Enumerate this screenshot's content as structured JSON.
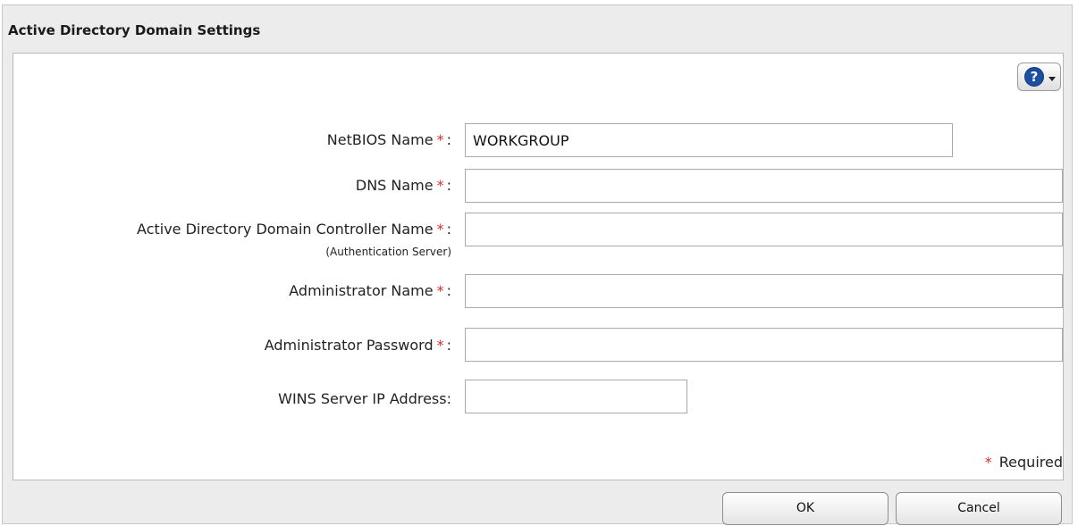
{
  "dialog": {
    "title": "Active Directory Domain Settings"
  },
  "help": {
    "icon": "question-mark-icon",
    "glyph": "?"
  },
  "form": {
    "netbios": {
      "label": "NetBIOS Name",
      "required_mark": "*",
      "colon": ":",
      "value": "WORKGROUP"
    },
    "dns": {
      "label": "DNS Name",
      "required_mark": "*",
      "colon": ":",
      "value": ""
    },
    "ad_controller": {
      "label": "Active Directory Domain Controller Name",
      "required_mark": "*",
      "colon": ":",
      "sublabel": "(Authentication Server)",
      "value": ""
    },
    "admin_name": {
      "label": "Administrator Name",
      "required_mark": "*",
      "colon": ":",
      "value": ""
    },
    "admin_password": {
      "label": "Administrator Password",
      "required_mark": "*",
      "colon": ":",
      "value": ""
    },
    "wins": {
      "label": "WINS Server IP Address:",
      "value": ""
    }
  },
  "required_note": {
    "mark": "*",
    "text": "Required"
  },
  "buttons": {
    "ok": "OK",
    "cancel": "Cancel"
  },
  "colors": {
    "required": "#e02a2a",
    "help": "#1b4fa0"
  }
}
